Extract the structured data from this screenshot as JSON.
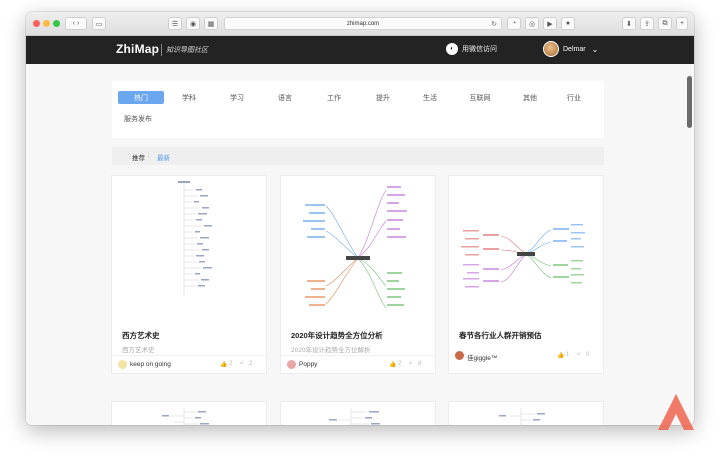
{
  "browser": {
    "url": "zhimap.com",
    "reader_label": "⊞"
  },
  "header": {
    "logo": "ZhiMap",
    "tagline": "知识导图社区",
    "wechat_label": "用微信访问",
    "user_name": "Delmar"
  },
  "categories": [
    "热门",
    "学科",
    "学习",
    "语言",
    "工作",
    "提升",
    "生活",
    "互联网",
    "其他",
    "行业",
    "服务发布"
  ],
  "active_category": "热门",
  "sort": {
    "recommend": "推荐",
    "latest": "最新"
  },
  "cards": [
    {
      "title": "西方艺术史",
      "subtitle": "西方艺术史",
      "author": "keep on going",
      "likes": "2",
      "shares": "2"
    },
    {
      "title": "2020年设计趋势全方位分析",
      "subtitle": "2020年设计趋势全方位解析",
      "author": "Poppy",
      "likes": "2",
      "shares": "8"
    },
    {
      "title": "春节各行业人群开销预估",
      "subtitle": "",
      "author": "佳giggle™",
      "likes": "1",
      "shares": "0"
    }
  ],
  "colors": {
    "header_bg": "#232323",
    "accent": "#6aa7ee",
    "page_bg": "#f7f7f7"
  }
}
